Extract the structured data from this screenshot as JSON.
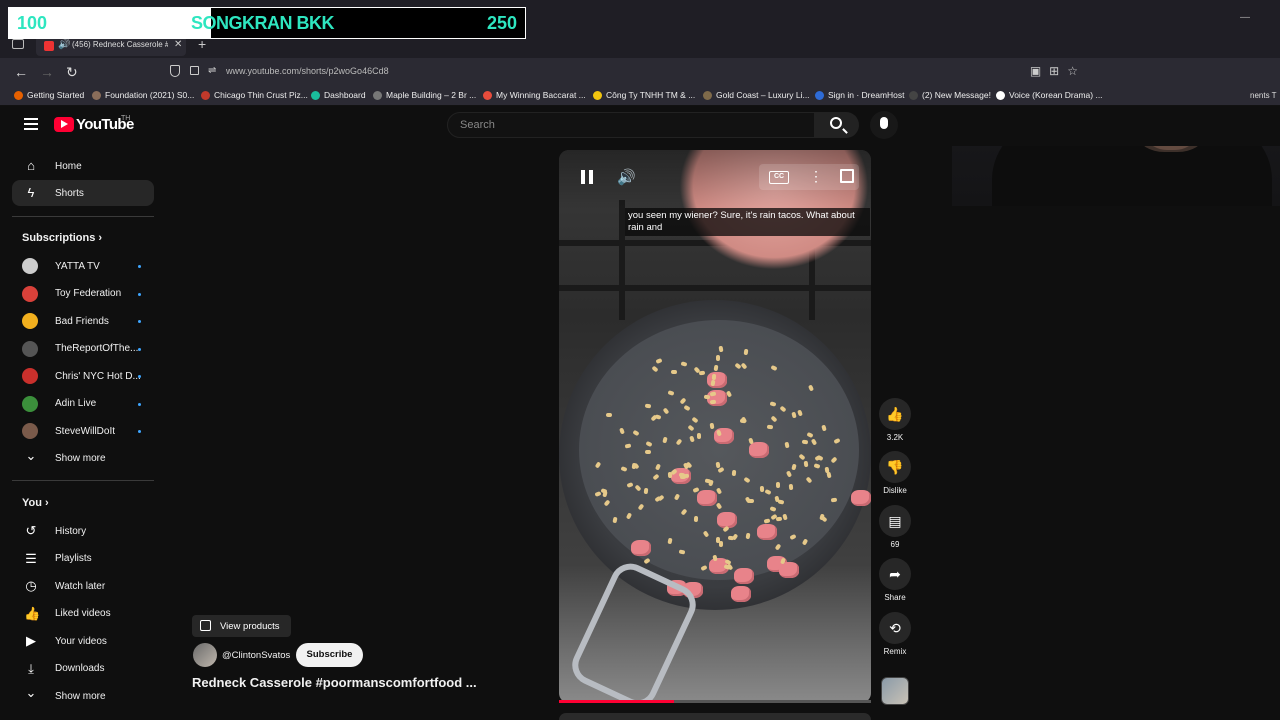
{
  "overlay": {
    "left_num": "100",
    "title": "SONGKRAN BKK",
    "right_num": "250"
  },
  "browser": {
    "tab_title": "(456) Redneck Casserole #p",
    "url": "www.youtube.com/shorts/p2woGo46Cd8",
    "bookmarks": [
      {
        "label": "Getting Started",
        "color": "#e66000"
      },
      {
        "label": "Foundation (2021) S0...",
        "color": "#8a6d5a"
      },
      {
        "label": "Chicago Thin Crust Piz...",
        "color": "#c0392b"
      },
      {
        "label": "Dashboard",
        "color": "#1abc9c"
      },
      {
        "label": "Maple Building – 2 Br ...",
        "color": "#777777"
      },
      {
        "label": "My Winning Baccarat ...",
        "color": "#e74c3c"
      },
      {
        "label": "Công Ty TNHH TM & ...",
        "color": "#f1c40f"
      },
      {
        "label": "Gold Coast – Luxury Li...",
        "color": "#7f6a4a"
      },
      {
        "label": "Sign in · DreamHost",
        "color": "#2e6bd6"
      },
      {
        "label": "(2) New Message!",
        "color": "#444444"
      },
      {
        "label": "Voice (Korean Drama) ...",
        "color": "#ffffff"
      }
    ],
    "overflow_text": "nents T"
  },
  "youtube": {
    "logo_text": "YouTube",
    "country_code": "TH",
    "search_placeholder": "Search"
  },
  "sidebar": {
    "main": [
      {
        "label": "Home",
        "icon": "home-icon",
        "active": false
      },
      {
        "label": "Shorts",
        "icon": "shorts-icon",
        "active": true
      }
    ],
    "subscriptions_heading": "Subscriptions",
    "subscriptions": [
      {
        "label": "YATTA TV",
        "avatar_color": "#cccccc"
      },
      {
        "label": "Toy Federation",
        "avatar_color": "#d9413a"
      },
      {
        "label": "Bad Friends",
        "avatar_color": "#f2b01e"
      },
      {
        "label": "TheReportOfThe...",
        "avatar_color": "#555555"
      },
      {
        "label": "Chris' NYC Hot D...",
        "avatar_color": "#c9302c"
      },
      {
        "label": "Adin Live",
        "avatar_color": "#3b8f3b"
      },
      {
        "label": "SteveWillDoIt",
        "avatar_color": "#7a5a4a"
      }
    ],
    "show_more_1": "Show more",
    "you_heading": "You",
    "you_items": [
      {
        "label": "History",
        "icon": "history-icon"
      },
      {
        "label": "Playlists",
        "icon": "playlists-icon"
      },
      {
        "label": "Watch later",
        "icon": "watch-later-icon"
      },
      {
        "label": "Liked videos",
        "icon": "liked-videos-icon"
      },
      {
        "label": "Your videos",
        "icon": "your-videos-icon"
      },
      {
        "label": "Downloads",
        "icon": "downloads-icon"
      }
    ],
    "show_more_2": "Show more"
  },
  "short": {
    "caption": "you seen my wiener? Sure, it's rain tacos. What about rain and",
    "cc_label": "CC",
    "progress": 0.37,
    "actions": {
      "like_count": "3.2K",
      "dislike_label": "Dislike",
      "comment_count": "69",
      "share_label": "Share",
      "remix_label": "Remix"
    },
    "view_products": "View products",
    "channel": "@ClintonSvatos",
    "subscribe": "Subscribe",
    "title": "Redneck Casserole #poormanscomfortfood ..."
  }
}
